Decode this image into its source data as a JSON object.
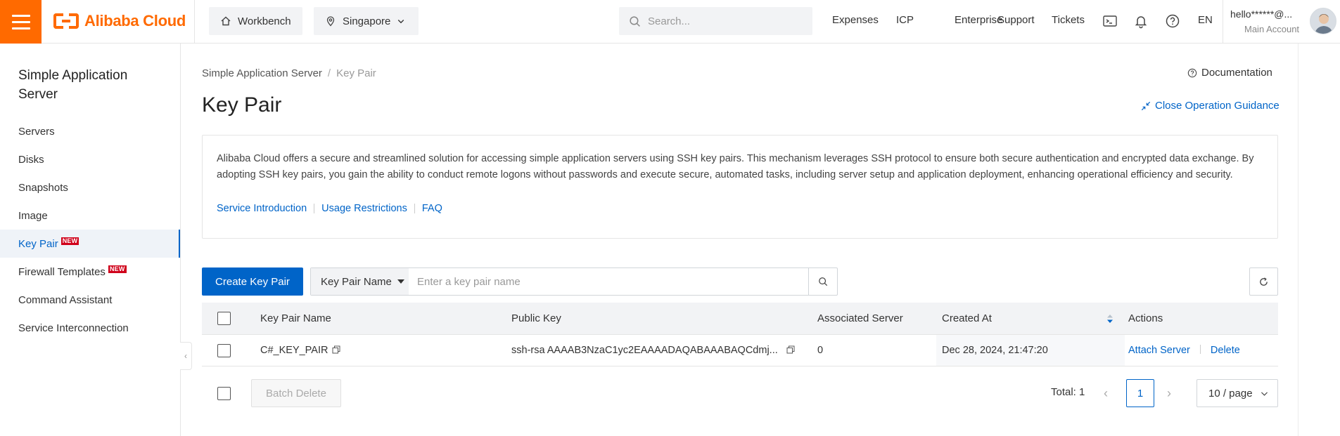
{
  "topbar": {
    "brand": "Alibaba Cloud",
    "workbench": "Workbench",
    "region": "Singapore",
    "search_placeholder": "Search...",
    "links": [
      "Expenses",
      "ICP",
      "Enterprise",
      "Support",
      "Tickets"
    ],
    "icons": [
      "terminal-icon",
      "bell-icon",
      "help-icon"
    ],
    "language": "EN",
    "account_name": "hello******@...",
    "account_role": "Main Account"
  },
  "sidebar": {
    "title": "Simple Application Server",
    "items": [
      {
        "label": "Servers"
      },
      {
        "label": "Disks"
      },
      {
        "label": "Snapshots"
      },
      {
        "label": "Image"
      },
      {
        "label": "Key Pair",
        "badge": "NEW",
        "active": true
      },
      {
        "label": "Firewall Templates",
        "badge": "NEW"
      },
      {
        "label": "Command Assistant"
      },
      {
        "label": "Service Interconnection"
      }
    ]
  },
  "breadcrumb": {
    "parent": "Simple Application Server",
    "separator": "/",
    "current": "Key Pair"
  },
  "documentation": "Documentation",
  "page_title": "Key Pair",
  "close_guidance": "Close Operation Guidance",
  "intro": {
    "text": "Alibaba Cloud offers a secure and streamlined solution for accessing simple application servers using SSH key pairs. This mechanism leverages SSH protocol to ensure both secure authentication and encrypted data exchange. By adopting SSH key pairs, you gain the ability to conduct remote logons without passwords and execute secure, automated tasks, including server setup and application deployment, enhancing operational efficiency and security.",
    "links": [
      "Service Introduction",
      "Usage Restrictions",
      "FAQ"
    ]
  },
  "toolbar": {
    "create_label": "Create Key Pair",
    "filter_field": "Key Pair Name",
    "filter_placeholder": "Enter a key pair name"
  },
  "table": {
    "columns": [
      "Key Pair Name",
      "Public Key",
      "Associated Server",
      "Created At",
      "Actions"
    ],
    "rows": [
      {
        "name": "C#_KEY_PAIR",
        "public_key": "ssh-rsa AAAAB3NzaC1yc2EAAAADAQABAAABAQCdmj...",
        "associated_server": "0",
        "created_at": "Dec 28, 2024, 21:47:20",
        "actions": [
          "Attach Server",
          "Delete"
        ]
      }
    ]
  },
  "footer": {
    "batch_delete": "Batch Delete",
    "total": "Total: 1",
    "current_page": "1",
    "page_size": "10 / page"
  },
  "colors": {
    "accent": "#0064c8",
    "brand": "#ff6a00",
    "badge": "#d0021b"
  }
}
